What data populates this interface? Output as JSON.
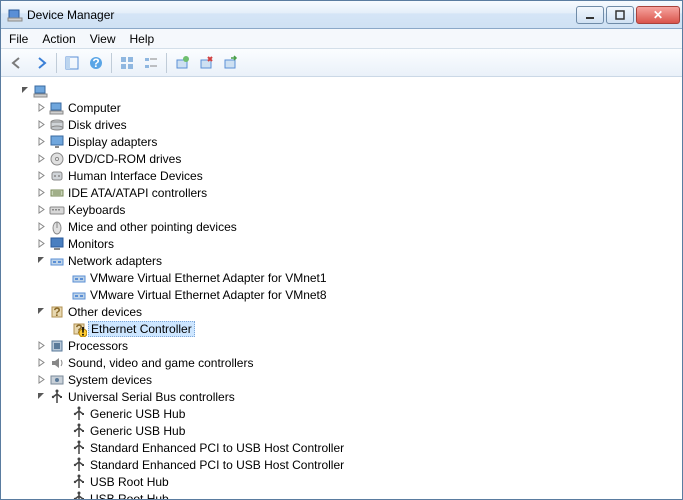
{
  "window": {
    "title": "Device Manager"
  },
  "menu": {
    "file": "File",
    "action": "Action",
    "view": "View",
    "help": "Help"
  },
  "toolbar_icons": {
    "back": "back-arrow",
    "forward": "forward-arrow",
    "sep1": true,
    "showhide": "showhide",
    "help": "help",
    "sep2": true,
    "tree1": "tree-grid",
    "tree2": "tree-list",
    "sep3": true,
    "scan": "scan",
    "disable": "disable",
    "uninstall": "uninstall"
  },
  "tree": {
    "root": {
      "label": "",
      "expanded": true
    },
    "nodes": [
      {
        "key": "computer",
        "label": "Computer",
        "icon": "computer",
        "expanded": false,
        "children": []
      },
      {
        "key": "disk",
        "label": "Disk drives",
        "icon": "disk",
        "expanded": false,
        "children": []
      },
      {
        "key": "display",
        "label": "Display adapters",
        "icon": "display",
        "expanded": false,
        "children": []
      },
      {
        "key": "dvd",
        "label": "DVD/CD-ROM drives",
        "icon": "dvd",
        "expanded": false,
        "children": []
      },
      {
        "key": "hid",
        "label": "Human Interface Devices",
        "icon": "hid",
        "expanded": false,
        "children": []
      },
      {
        "key": "ide",
        "label": "IDE ATA/ATAPI controllers",
        "icon": "ide",
        "expanded": false,
        "children": []
      },
      {
        "key": "keyboards",
        "label": "Keyboards",
        "icon": "keyboard",
        "expanded": false,
        "children": []
      },
      {
        "key": "mice",
        "label": "Mice and other pointing devices",
        "icon": "mouse",
        "expanded": false,
        "children": []
      },
      {
        "key": "monitors",
        "label": "Monitors",
        "icon": "monitor",
        "expanded": false,
        "children": []
      },
      {
        "key": "network",
        "label": "Network adapters",
        "icon": "network",
        "expanded": true,
        "children": [
          {
            "key": "vmnet1",
            "label": "VMware Virtual Ethernet Adapter for VMnet1",
            "icon": "network"
          },
          {
            "key": "vmnet8",
            "label": "VMware Virtual Ethernet Adapter for VMnet8",
            "icon": "network"
          }
        ]
      },
      {
        "key": "other",
        "label": "Other devices",
        "icon": "other",
        "expanded": true,
        "children": [
          {
            "key": "eth",
            "label": "Ethernet Controller",
            "icon": "unknown",
            "selected": true,
            "warning": true
          }
        ]
      },
      {
        "key": "processors",
        "label": "Processors",
        "icon": "cpu",
        "expanded": false,
        "children": []
      },
      {
        "key": "sound",
        "label": "Sound, video and game controllers",
        "icon": "sound",
        "expanded": false,
        "children": []
      },
      {
        "key": "system",
        "label": "System devices",
        "icon": "system",
        "expanded": false,
        "children": []
      },
      {
        "key": "usb",
        "label": "Universal Serial Bus controllers",
        "icon": "usb",
        "expanded": true,
        "children": [
          {
            "key": "ghub1",
            "label": "Generic USB Hub",
            "icon": "usb"
          },
          {
            "key": "ghub2",
            "label": "Generic USB Hub",
            "icon": "usb"
          },
          {
            "key": "enh1",
            "label": "Standard Enhanced PCI to USB Host Controller",
            "icon": "usb"
          },
          {
            "key": "enh2",
            "label": "Standard Enhanced PCI to USB Host Controller",
            "icon": "usb"
          },
          {
            "key": "uroot1",
            "label": "USB Root Hub",
            "icon": "usb"
          },
          {
            "key": "uroot2",
            "label": "USB Root Hub",
            "icon": "usb"
          }
        ]
      }
    ]
  }
}
